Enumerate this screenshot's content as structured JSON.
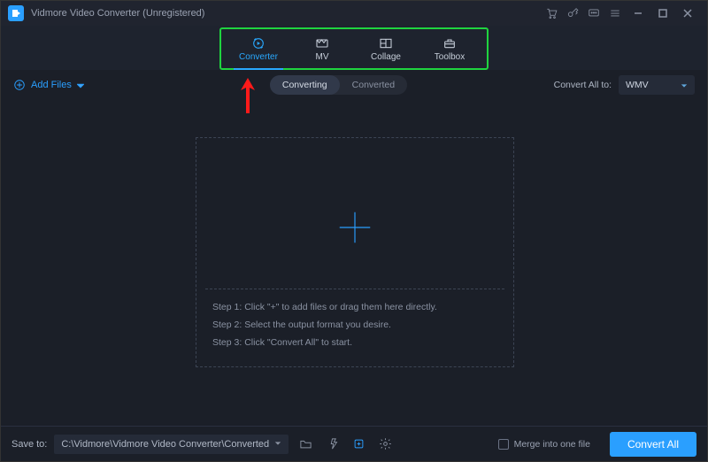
{
  "titlebar": {
    "title": "Vidmore Video Converter (Unregistered)"
  },
  "tabs": {
    "items": [
      {
        "label": "Converter"
      },
      {
        "label": "MV"
      },
      {
        "label": "Collage"
      },
      {
        "label": "Toolbox"
      }
    ]
  },
  "subhead": {
    "add_files": "Add Files",
    "converting": "Converting",
    "converted": "Converted",
    "convert_all_to": "Convert All to:",
    "format": "WMV"
  },
  "drop": {
    "step1": "Step 1: Click \"+\" to add files or drag them here directly.",
    "step2": "Step 2: Select the output format you desire.",
    "step3": "Step 3: Click \"Convert All\" to start."
  },
  "footer": {
    "save_to_label": "Save to:",
    "save_to_path": "C:\\Vidmore\\Vidmore Video Converter\\Converted",
    "merge_label": "Merge into one file",
    "convert_all": "Convert All"
  }
}
